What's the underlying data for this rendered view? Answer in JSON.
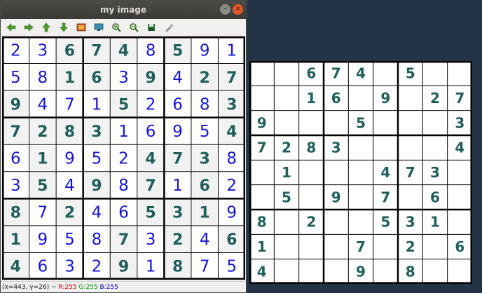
{
  "window": {
    "title": "my image",
    "minimize_icon": "minimize-icon",
    "close_icon": "close-icon"
  },
  "toolbar": {
    "buttons": [
      "left-arrow-icon",
      "right-arrow-icon",
      "up-arrow-icon",
      "down-arrow-icon",
      "image-icon",
      "fit-icon",
      "zoom-in-icon",
      "zoom-out-icon",
      "save-icon",
      "properties-icon"
    ]
  },
  "status": {
    "coords": "(x=443, y=26) ~ ",
    "r": "R:255",
    "g": "G:255",
    "b": "B:255"
  },
  "colors": {
    "given": "#1f5f5a",
    "solved": "#1515d8",
    "grid": "#000000",
    "cell_shade": "#f2f2f2"
  },
  "solution": [
    [
      2,
      3,
      6,
      7,
      4,
      8,
      5,
      9,
      1
    ],
    [
      5,
      8,
      1,
      6,
      3,
      9,
      4,
      2,
      7
    ],
    [
      9,
      4,
      7,
      1,
      5,
      2,
      6,
      8,
      3
    ],
    [
      7,
      2,
      8,
      3,
      1,
      6,
      9,
      5,
      4
    ],
    [
      6,
      1,
      9,
      5,
      2,
      4,
      7,
      3,
      8
    ],
    [
      3,
      5,
      4,
      9,
      8,
      7,
      1,
      6,
      2
    ],
    [
      8,
      7,
      2,
      4,
      6,
      5,
      3,
      1,
      9
    ],
    [
      1,
      9,
      5,
      8,
      7,
      3,
      2,
      4,
      6
    ],
    [
      4,
      6,
      3,
      2,
      9,
      1,
      8,
      7,
      5
    ]
  ],
  "puzzle": [
    [
      0,
      0,
      6,
      7,
      4,
      0,
      5,
      0,
      0
    ],
    [
      0,
      0,
      1,
      6,
      0,
      9,
      0,
      2,
      7
    ],
    [
      9,
      0,
      0,
      0,
      5,
      0,
      0,
      0,
      3
    ],
    [
      7,
      2,
      8,
      3,
      0,
      0,
      0,
      0,
      4
    ],
    [
      0,
      1,
      0,
      0,
      0,
      4,
      7,
      3,
      0
    ],
    [
      0,
      5,
      0,
      9,
      0,
      7,
      0,
      6,
      0
    ],
    [
      8,
      0,
      2,
      0,
      0,
      5,
      3,
      1,
      0
    ],
    [
      1,
      0,
      0,
      0,
      7,
      0,
      2,
      0,
      6
    ],
    [
      4,
      0,
      0,
      0,
      9,
      0,
      8,
      0,
      0
    ]
  ]
}
